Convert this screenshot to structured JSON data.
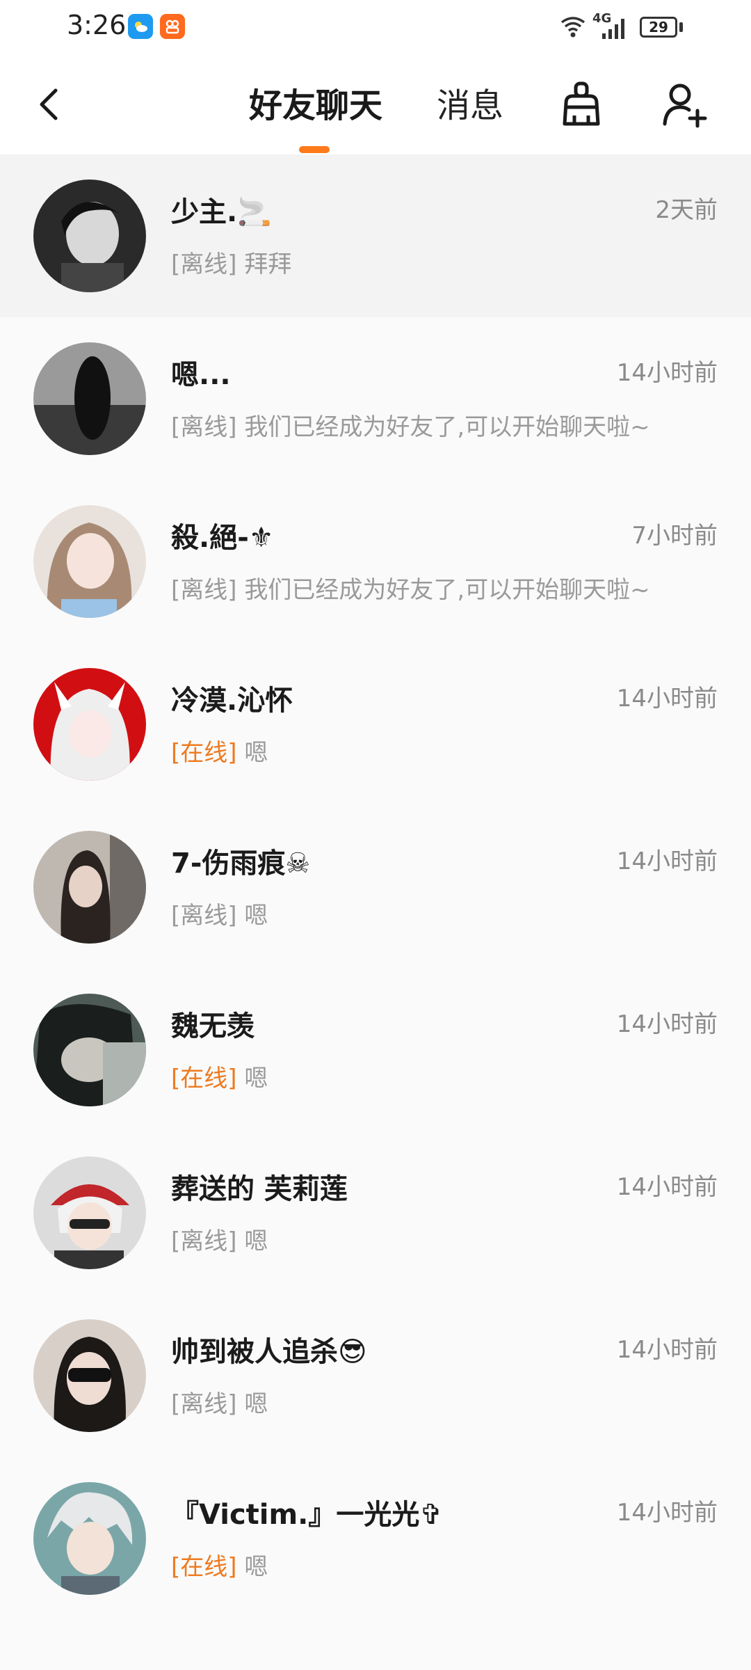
{
  "status_bar": {
    "time": "3:26",
    "network": "4G",
    "battery": "29"
  },
  "header": {
    "tabs": [
      {
        "label": "好友聊天",
        "active": true
      },
      {
        "label": "消息",
        "active": false
      }
    ],
    "accent_color": "#ff7a1a"
  },
  "contacts": [
    {
      "name": "少主.🚬",
      "time": "2天前",
      "status": "[离线]",
      "online": false,
      "message": "拜拜"
    },
    {
      "name": "嗯...",
      "time": "14小时前",
      "status": "[离线]",
      "online": false,
      "message": "我们已经成为好友了,可以开始聊天啦~"
    },
    {
      "name": "殺.絕-⚜",
      "time": "7小时前",
      "status": "[离线]",
      "online": false,
      "message": "我们已经成为好友了,可以开始聊天啦~"
    },
    {
      "name": "冷漠.沁怀",
      "time": "14小时前",
      "status": "[在线]",
      "online": true,
      "message": "嗯"
    },
    {
      "name": "7-伤雨痕☠",
      "time": "14小时前",
      "status": "[离线]",
      "online": false,
      "message": "嗯"
    },
    {
      "name": "魏无羡",
      "time": "14小时前",
      "status": "[在线]",
      "online": true,
      "message": "嗯"
    },
    {
      "name": "葬送的 芙莉莲",
      "time": "14小时前",
      "status": "[离线]",
      "online": false,
      "message": "嗯"
    },
    {
      "name": "帅到被人追杀😎",
      "time": "14小时前",
      "status": "[离线]",
      "online": false,
      "message": "嗯"
    },
    {
      "name": "『Victim.』一光光✞",
      "time": "14小时前",
      "status": "[在线]",
      "online": true,
      "message": "嗯"
    }
  ]
}
